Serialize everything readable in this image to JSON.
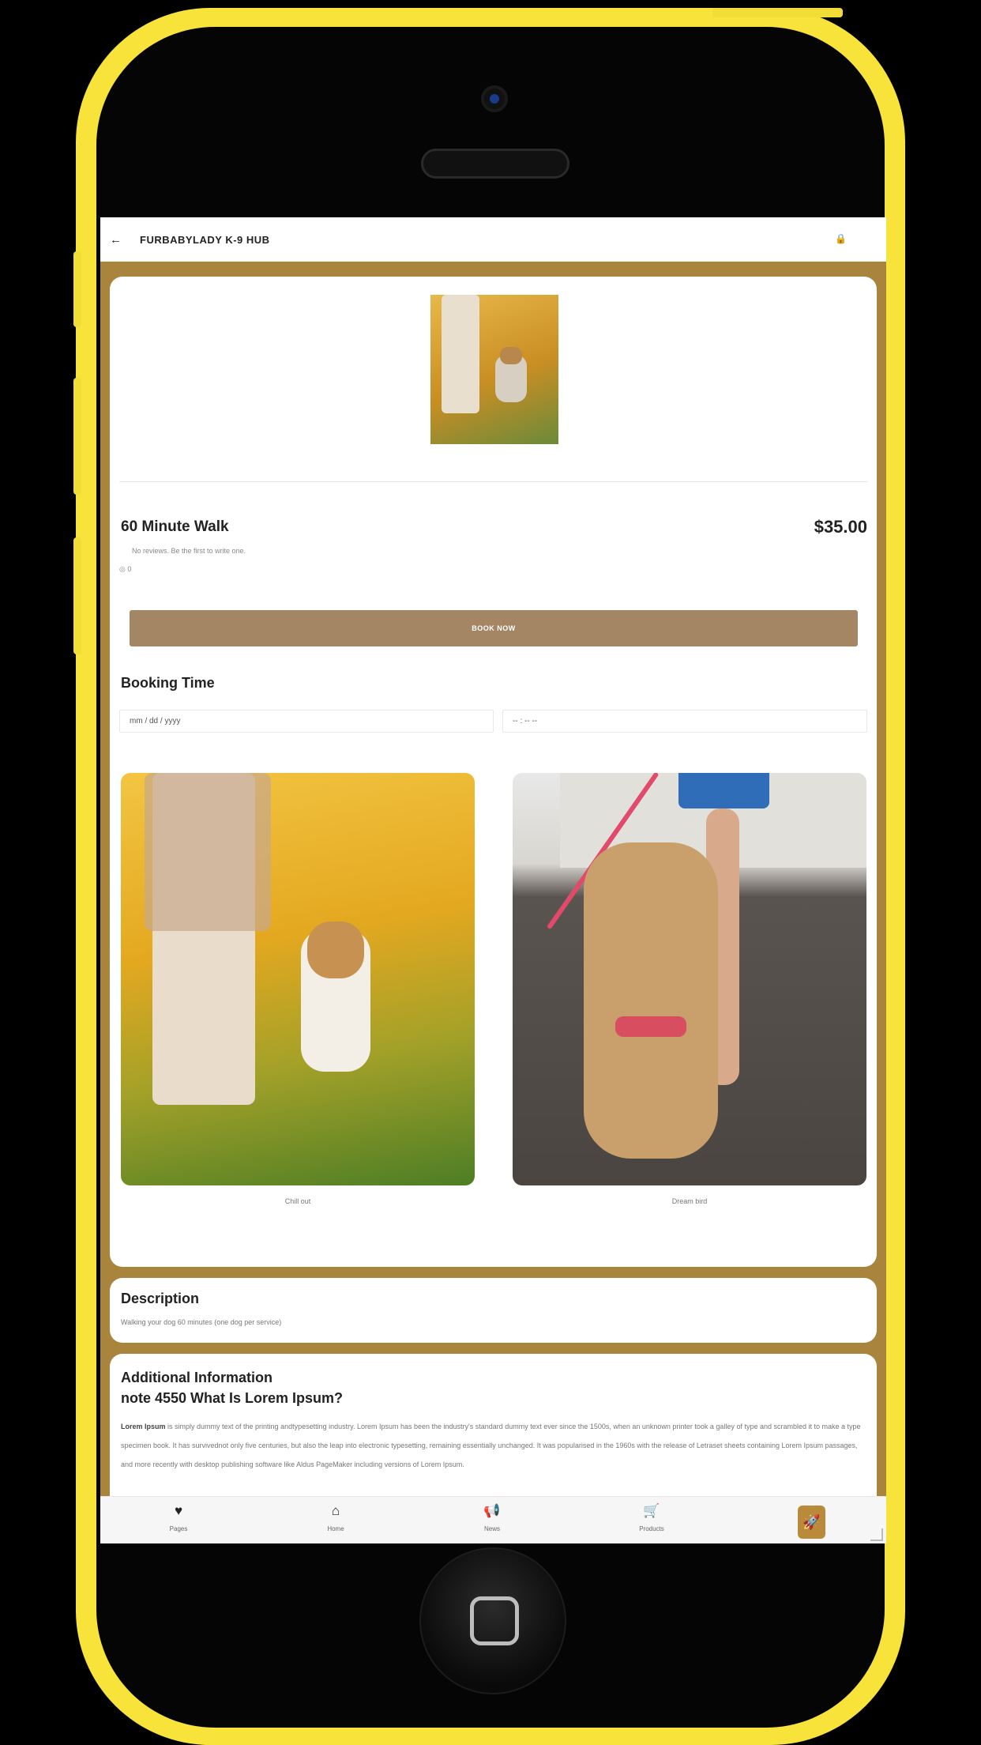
{
  "app": {
    "title": "FURBABYLADY K-9 HUB",
    "back_icon": "←",
    "lock_icon": "🔒"
  },
  "product": {
    "name": "60 Minute Walk",
    "price": "$35.00",
    "reviews_text": "No reviews. Be the first to write one.",
    "views_icon": "◎",
    "views_count": "0",
    "book_label": "BOOK NOW"
  },
  "booking": {
    "label": "Booking Time",
    "date_placeholder": "mm / dd / yyyy",
    "time_placeholder": "-- : -- --"
  },
  "gallery": {
    "items": [
      {
        "caption": "Chill out"
      },
      {
        "caption": "Dream bird"
      }
    ]
  },
  "description": {
    "heading": "Description",
    "text": "Walking your dog 60 minutes (one dog per service)"
  },
  "additional_info": {
    "heading": "Additional Information",
    "subheading": "note 4550 What Is Lorem Ipsum?",
    "lead": "Lorem Ipsum",
    "body": " is simply dummy text of the printing andtypesetting industry. Lorem Ipsum has been the industry's standard dummy text ever since the 1500s, when an unknown printer took a galley of type and scrambled it to make a type specimen book. It has survivednot only five centuries, but also the leap into electronic typesetting, remaining essentially unchanged. It was popularised in the 1960s with the release of Letraset sheets containing Lorem Ipsum passages, and more recently with desktop publishing software like Aldus PageMaker including versions of Lorem Ipsum."
  },
  "bottom_nav": {
    "items": [
      {
        "label": "Pages",
        "icon": "heart-icon",
        "glyph": "♥"
      },
      {
        "label": "Home",
        "icon": "home-icon",
        "glyph": "⌂"
      },
      {
        "label": "News",
        "icon": "megaphone-icon",
        "glyph": "📢"
      },
      {
        "label": "Products",
        "icon": "cart-icon",
        "glyph": "🛒"
      }
    ],
    "fab_icon": "rocket-icon",
    "fab_glyph": "🚀"
  },
  "colors": {
    "background": "#a8843c",
    "book_button": "#a48664",
    "fab": "#b98a3a",
    "phone_frame": "#f7e33a"
  }
}
